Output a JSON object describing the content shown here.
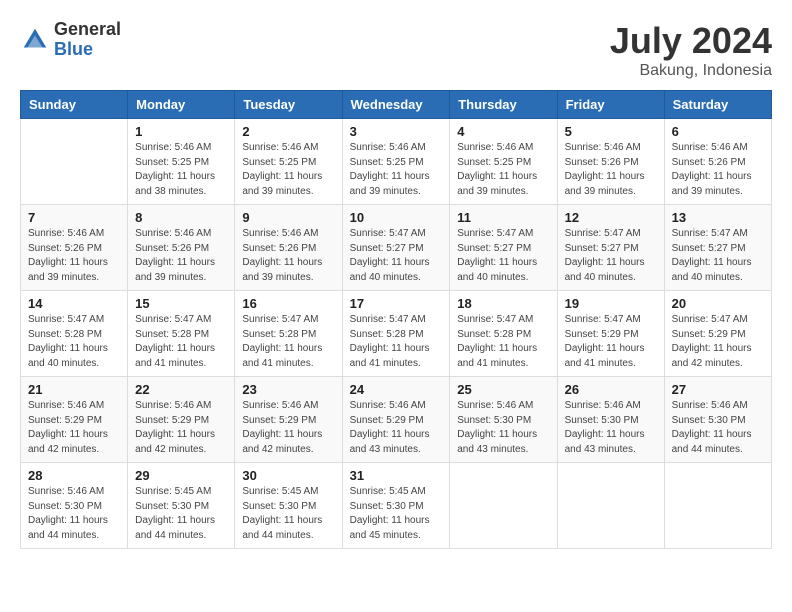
{
  "header": {
    "logo_general": "General",
    "logo_blue": "Blue",
    "month_year": "July 2024",
    "location": "Bakung, Indonesia"
  },
  "days_of_week": [
    "Sunday",
    "Monday",
    "Tuesday",
    "Wednesday",
    "Thursday",
    "Friday",
    "Saturday"
  ],
  "weeks": [
    [
      {
        "day": "",
        "info": ""
      },
      {
        "day": "1",
        "info": "Sunrise: 5:46 AM\nSunset: 5:25 PM\nDaylight: 11 hours\nand 38 minutes."
      },
      {
        "day": "2",
        "info": "Sunrise: 5:46 AM\nSunset: 5:25 PM\nDaylight: 11 hours\nand 39 minutes."
      },
      {
        "day": "3",
        "info": "Sunrise: 5:46 AM\nSunset: 5:25 PM\nDaylight: 11 hours\nand 39 minutes."
      },
      {
        "day": "4",
        "info": "Sunrise: 5:46 AM\nSunset: 5:25 PM\nDaylight: 11 hours\nand 39 minutes."
      },
      {
        "day": "5",
        "info": "Sunrise: 5:46 AM\nSunset: 5:26 PM\nDaylight: 11 hours\nand 39 minutes."
      },
      {
        "day": "6",
        "info": "Sunrise: 5:46 AM\nSunset: 5:26 PM\nDaylight: 11 hours\nand 39 minutes."
      }
    ],
    [
      {
        "day": "7",
        "info": "Sunrise: 5:46 AM\nSunset: 5:26 PM\nDaylight: 11 hours\nand 39 minutes."
      },
      {
        "day": "8",
        "info": "Sunrise: 5:46 AM\nSunset: 5:26 PM\nDaylight: 11 hours\nand 39 minutes."
      },
      {
        "day": "9",
        "info": "Sunrise: 5:46 AM\nSunset: 5:26 PM\nDaylight: 11 hours\nand 39 minutes."
      },
      {
        "day": "10",
        "info": "Sunrise: 5:47 AM\nSunset: 5:27 PM\nDaylight: 11 hours\nand 40 minutes."
      },
      {
        "day": "11",
        "info": "Sunrise: 5:47 AM\nSunset: 5:27 PM\nDaylight: 11 hours\nand 40 minutes."
      },
      {
        "day": "12",
        "info": "Sunrise: 5:47 AM\nSunset: 5:27 PM\nDaylight: 11 hours\nand 40 minutes."
      },
      {
        "day": "13",
        "info": "Sunrise: 5:47 AM\nSunset: 5:27 PM\nDaylight: 11 hours\nand 40 minutes."
      }
    ],
    [
      {
        "day": "14",
        "info": "Sunrise: 5:47 AM\nSunset: 5:28 PM\nDaylight: 11 hours\nand 40 minutes."
      },
      {
        "day": "15",
        "info": "Sunrise: 5:47 AM\nSunset: 5:28 PM\nDaylight: 11 hours\nand 41 minutes."
      },
      {
        "day": "16",
        "info": "Sunrise: 5:47 AM\nSunset: 5:28 PM\nDaylight: 11 hours\nand 41 minutes."
      },
      {
        "day": "17",
        "info": "Sunrise: 5:47 AM\nSunset: 5:28 PM\nDaylight: 11 hours\nand 41 minutes."
      },
      {
        "day": "18",
        "info": "Sunrise: 5:47 AM\nSunset: 5:28 PM\nDaylight: 11 hours\nand 41 minutes."
      },
      {
        "day": "19",
        "info": "Sunrise: 5:47 AM\nSunset: 5:29 PM\nDaylight: 11 hours\nand 41 minutes."
      },
      {
        "day": "20",
        "info": "Sunrise: 5:47 AM\nSunset: 5:29 PM\nDaylight: 11 hours\nand 42 minutes."
      }
    ],
    [
      {
        "day": "21",
        "info": "Sunrise: 5:46 AM\nSunset: 5:29 PM\nDaylight: 11 hours\nand 42 minutes."
      },
      {
        "day": "22",
        "info": "Sunrise: 5:46 AM\nSunset: 5:29 PM\nDaylight: 11 hours\nand 42 minutes."
      },
      {
        "day": "23",
        "info": "Sunrise: 5:46 AM\nSunset: 5:29 PM\nDaylight: 11 hours\nand 42 minutes."
      },
      {
        "day": "24",
        "info": "Sunrise: 5:46 AM\nSunset: 5:29 PM\nDaylight: 11 hours\nand 43 minutes."
      },
      {
        "day": "25",
        "info": "Sunrise: 5:46 AM\nSunset: 5:30 PM\nDaylight: 11 hours\nand 43 minutes."
      },
      {
        "day": "26",
        "info": "Sunrise: 5:46 AM\nSunset: 5:30 PM\nDaylight: 11 hours\nand 43 minutes."
      },
      {
        "day": "27",
        "info": "Sunrise: 5:46 AM\nSunset: 5:30 PM\nDaylight: 11 hours\nand 44 minutes."
      }
    ],
    [
      {
        "day": "28",
        "info": "Sunrise: 5:46 AM\nSunset: 5:30 PM\nDaylight: 11 hours\nand 44 minutes."
      },
      {
        "day": "29",
        "info": "Sunrise: 5:45 AM\nSunset: 5:30 PM\nDaylight: 11 hours\nand 44 minutes."
      },
      {
        "day": "30",
        "info": "Sunrise: 5:45 AM\nSunset: 5:30 PM\nDaylight: 11 hours\nand 44 minutes."
      },
      {
        "day": "31",
        "info": "Sunrise: 5:45 AM\nSunset: 5:30 PM\nDaylight: 11 hours\nand 45 minutes."
      },
      {
        "day": "",
        "info": ""
      },
      {
        "day": "",
        "info": ""
      },
      {
        "day": "",
        "info": ""
      }
    ]
  ]
}
